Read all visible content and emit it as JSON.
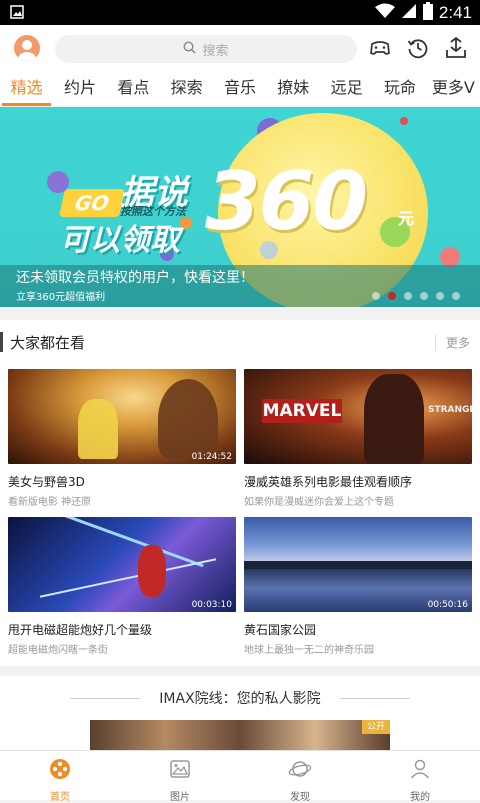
{
  "status_bar": {
    "time": "2:41"
  },
  "search": {
    "placeholder": "搜索"
  },
  "tabs": [
    {
      "label": "精选"
    },
    {
      "label": "约片"
    },
    {
      "label": "看点"
    },
    {
      "label": "探索"
    },
    {
      "label": "音乐"
    },
    {
      "label": "撩妹"
    },
    {
      "label": "远足"
    },
    {
      "label": "玩命"
    },
    {
      "label": "更多V"
    }
  ],
  "banner": {
    "go": "GO",
    "line1": "据说",
    "line2": "可以领取",
    "line3": "按照这个方法",
    "number": "360",
    "unit": "元",
    "caption": "还未领取会员特权的用户，快看这里！",
    "subcaption": "立享360元超值福利",
    "slide_count": 6,
    "active_slide": 1
  },
  "section": {
    "title": "大家都在看",
    "more": "更多",
    "cards": [
      {
        "title": "美女与野兽3D",
        "subtitle": "看新版电影 神还原",
        "duration": "01:24:52"
      },
      {
        "title": "漫威英雄系列电影最佳观看顺序",
        "subtitle": "如果你是漫威迷你会爱上这个专题",
        "duration": "",
        "poster_text_1": "MARVEL",
        "poster_text_2": "STRANGE"
      },
      {
        "title": "甩开电磁超能炮好几个量级",
        "subtitle": "超能电磁炮闪瞎一条街",
        "duration": "00:03:10"
      },
      {
        "title": "黄石国家公园",
        "subtitle": "地球上最独一无二的神奇乐园",
        "duration": "00:50:16"
      }
    ]
  },
  "imax": {
    "title": "IMAX院线：您的私人影院",
    "tag": "公开"
  },
  "bottom_nav": [
    {
      "label": "首页"
    },
    {
      "label": "图片"
    },
    {
      "label": "发现"
    },
    {
      "label": "我的"
    }
  ],
  "colors": {
    "accent": "#f08a24",
    "banner_bg": "#3fd5d3"
  }
}
